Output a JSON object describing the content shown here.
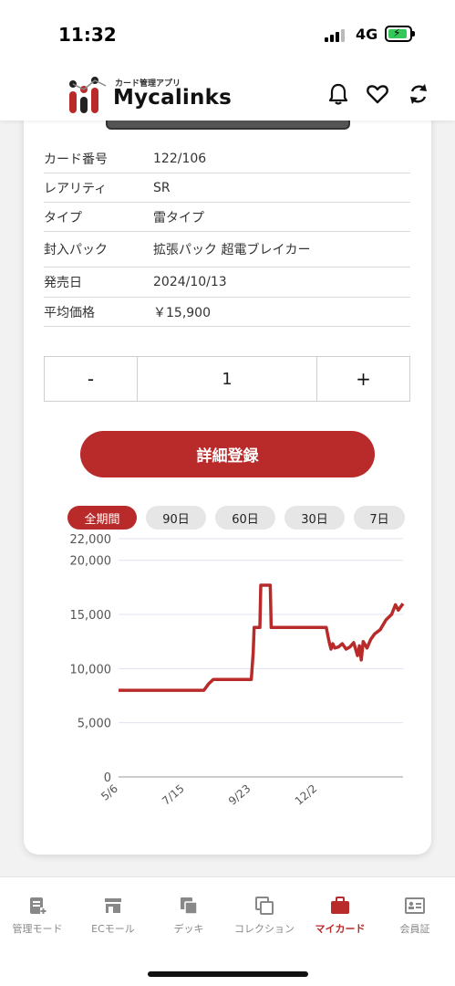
{
  "status": {
    "time": "11:32",
    "network": "4G"
  },
  "header": {
    "logo_sub": "カード管理アプリ",
    "logo_text": "Mycalinks"
  },
  "card_info": [
    {
      "label": "カード番号",
      "value": "122/106"
    },
    {
      "label": "レアリティ",
      "value": "SR"
    },
    {
      "label": "タイプ",
      "value": "雷タイプ"
    },
    {
      "label": "封入パック",
      "value": "拡張パック 超電ブレイカー"
    },
    {
      "label": "発売日",
      "value": "2024/10/13"
    },
    {
      "label": "平均価格",
      "value": "￥15,900"
    }
  ],
  "quantity": {
    "minus": "-",
    "value": "1",
    "plus": "+"
  },
  "register_label": "詳細登録",
  "periods": [
    {
      "label": "全期間",
      "active": true
    },
    {
      "label": "90日",
      "active": false
    },
    {
      "label": "60日",
      "active": false
    },
    {
      "label": "30日",
      "active": false
    },
    {
      "label": "7日",
      "active": false
    }
  ],
  "colors": {
    "accent": "#b92a2a"
  },
  "chart_data": {
    "type": "line",
    "ylim": [
      0,
      22000
    ],
    "yticks": [
      0,
      5000,
      10000,
      15000,
      20000,
      22000
    ],
    "ytick_labels": [
      "0",
      "5,000",
      "10,000",
      "15,000",
      "20,000",
      "22,000"
    ],
    "xtick_labels": [
      "5/6",
      "7/15",
      "9/23",
      "12/2"
    ],
    "xtick_positions": [
      0,
      70,
      140,
      210
    ],
    "x_max": 300,
    "series": [
      {
        "points": [
          [
            0,
            8000
          ],
          [
            90,
            8000
          ],
          [
            95,
            8600
          ],
          [
            100,
            9000
          ],
          [
            140,
            9000
          ],
          [
            142,
            11500
          ],
          [
            143,
            13800
          ],
          [
            149,
            13800
          ],
          [
            150,
            17700
          ],
          [
            160,
            17700
          ],
          [
            161,
            13800
          ],
          [
            219,
            13800
          ],
          [
            222,
            12500
          ],
          [
            224,
            11800
          ],
          [
            226,
            12300
          ],
          [
            228,
            11900
          ],
          [
            232,
            12000
          ],
          [
            236,
            12300
          ],
          [
            240,
            11800
          ],
          [
            244,
            12000
          ],
          [
            248,
            12400
          ],
          [
            252,
            11200
          ],
          [
            254,
            12100
          ],
          [
            256,
            10800
          ],
          [
            258,
            12500
          ],
          [
            262,
            11900
          ],
          [
            266,
            12700
          ],
          [
            270,
            13200
          ],
          [
            276,
            13600
          ],
          [
            282,
            14500
          ],
          [
            288,
            15000
          ],
          [
            292,
            15900
          ],
          [
            295,
            15400
          ],
          [
            300,
            16000
          ]
        ]
      }
    ]
  },
  "nav": [
    {
      "label": "管理モード",
      "icon": "manage-icon",
      "active": false
    },
    {
      "label": "ECモール",
      "icon": "store-icon",
      "active": false
    },
    {
      "label": "デッキ",
      "icon": "deck-icon",
      "active": false
    },
    {
      "label": "コレクション",
      "icon": "collection-icon",
      "active": false
    },
    {
      "label": "マイカード",
      "icon": "briefcase-icon",
      "active": true
    },
    {
      "label": "会員証",
      "icon": "member-card-icon",
      "active": false
    }
  ]
}
